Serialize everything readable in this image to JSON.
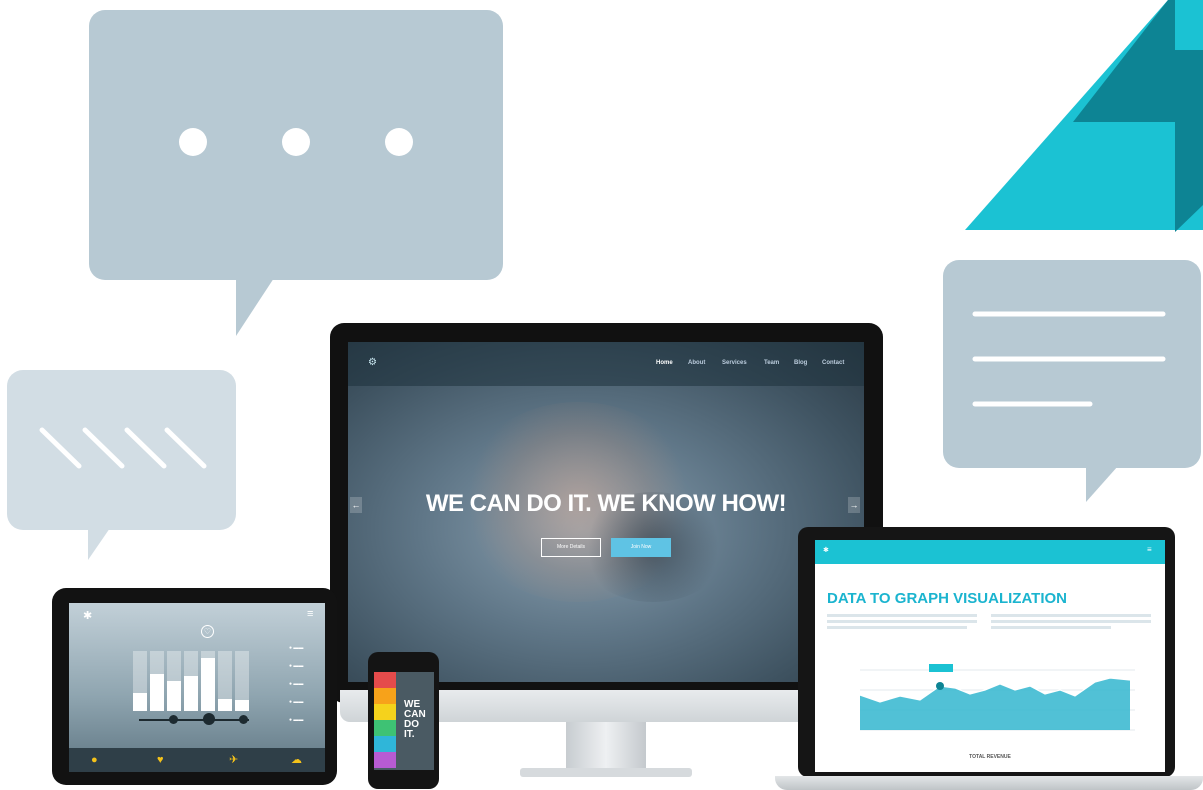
{
  "monitor": {
    "logo": "⚙",
    "nav": [
      "Home",
      "About",
      "Services",
      "Team",
      "Blog",
      "Contact"
    ],
    "hero_title": "WE CAN DO IT. WE KNOW HOW!",
    "button_more": "More Details",
    "button_join": "Join Now",
    "arrow_left": "←",
    "arrow_right": "→"
  },
  "phone": {
    "lines": [
      "WE",
      "CAN",
      "DO",
      "IT."
    ]
  },
  "laptop": {
    "title": "DATA TO GRAPH VISUALIZATION",
    "chart_footer": "TOTAL REVENUE"
  },
  "tablet": {
    "bars": [
      0.3,
      0.62,
      0.5,
      0.58,
      0.88,
      0.2,
      0.18
    ],
    "icons": [
      "lightbulb-icon",
      "heart-icon",
      "pin-icon",
      "cloud-icon"
    ]
  },
  "colors": {
    "teal": "#1bc2d3",
    "dark_teal": "#0d8494",
    "bubble": "#b7c9d3",
    "bubble_light": "#d2dde4"
  }
}
